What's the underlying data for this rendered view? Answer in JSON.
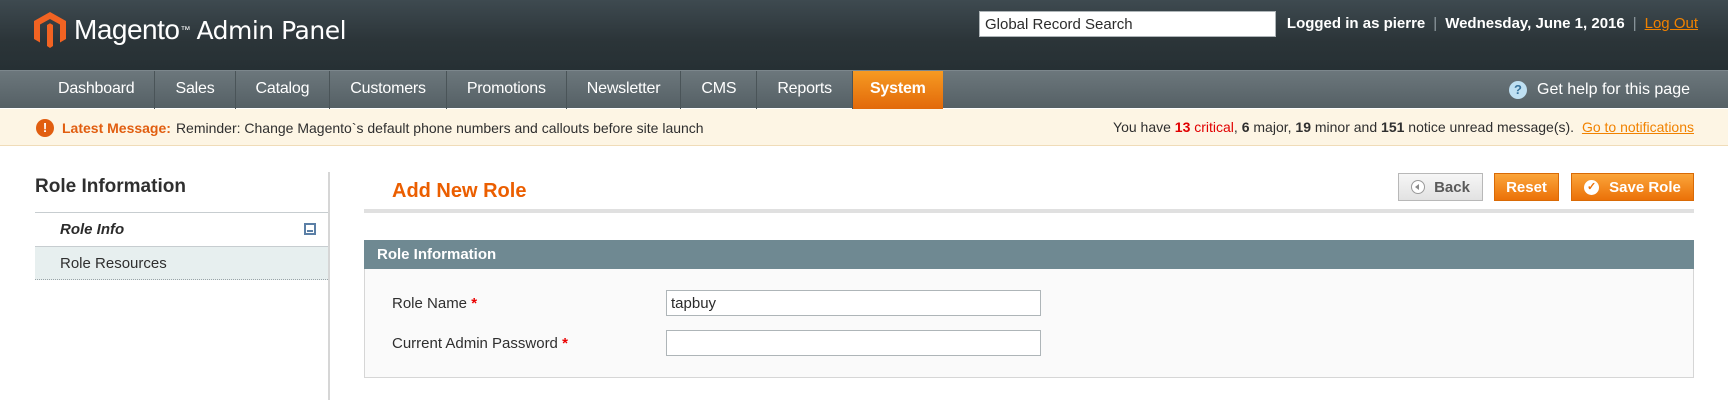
{
  "header": {
    "logo_name": "Magento",
    "logo_tm": "™",
    "logo_sub": "Admin Panel",
    "search_value": "Global Record Search",
    "logged_in": "Logged in as pierre",
    "date": "Wednesday, June 1, 2016",
    "logout": "Log Out",
    "separator": "|"
  },
  "nav": {
    "items": [
      "Dashboard",
      "Sales",
      "Catalog",
      "Customers",
      "Promotions",
      "Newsletter",
      "CMS",
      "Reports",
      "System"
    ],
    "active_item": "System",
    "help": "Get help for this page",
    "help_icon": "?"
  },
  "message": {
    "icon": "!",
    "label": "Latest Message:",
    "text": "Reminder: Change Magento`s default phone numbers and callouts before site launch",
    "you_have": "You have",
    "critical_count": "13",
    "critical_label": "critical",
    "major_count": "6",
    "major_label": "major,",
    "minor_count": "19",
    "minor_label": "minor and",
    "notice_count": "151",
    "notice_label": "notice unread message(s).",
    "link": "Go to notifications"
  },
  "sidebar": {
    "title": "Role Information",
    "tabs": [
      {
        "label": "Role Info",
        "active": true
      },
      {
        "label": "Role Resources",
        "active": false
      }
    ]
  },
  "main": {
    "title": "Add New Role",
    "buttons": {
      "back": "Back",
      "reset": "Reset",
      "save": "Save Role",
      "save_icon": "✓"
    },
    "fieldset": {
      "title": "Role Information",
      "fields": [
        {
          "label": "Role Name",
          "required": "*",
          "value": "tapbuy"
        },
        {
          "label": "Current Admin Password",
          "required": "*",
          "value": ""
        }
      ]
    }
  },
  "colors": {
    "accent": "#eb5e00",
    "nav_active": "#f18200",
    "header_bg": "#2b3438",
    "fieldset_head": "#6f8992",
    "critical": "#e10000"
  }
}
